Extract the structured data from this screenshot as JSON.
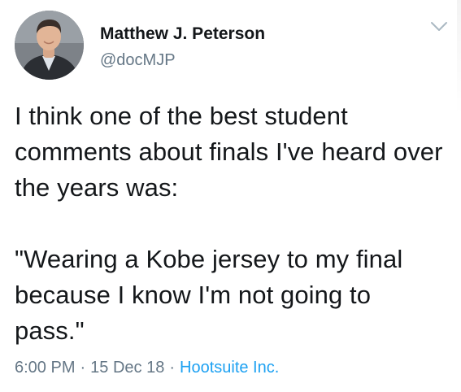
{
  "tweet": {
    "author": {
      "name": "Matthew J. Peterson",
      "handle": "@docMJP"
    },
    "text": "I think one of the best student comments about finals I've heard over the years was:\n\n\"Wearing a Kobe jersey to my final because I know I'm not going to pass.\"",
    "meta": {
      "time": "6:00 PM",
      "date": "15 Dec 18",
      "source": "Hootsuite Inc.",
      "separator": "·"
    }
  },
  "icons": {
    "menu": "chevron-down-icon"
  },
  "colors": {
    "text": "#14171a",
    "secondary": "#657786",
    "link": "#1da1f2"
  }
}
